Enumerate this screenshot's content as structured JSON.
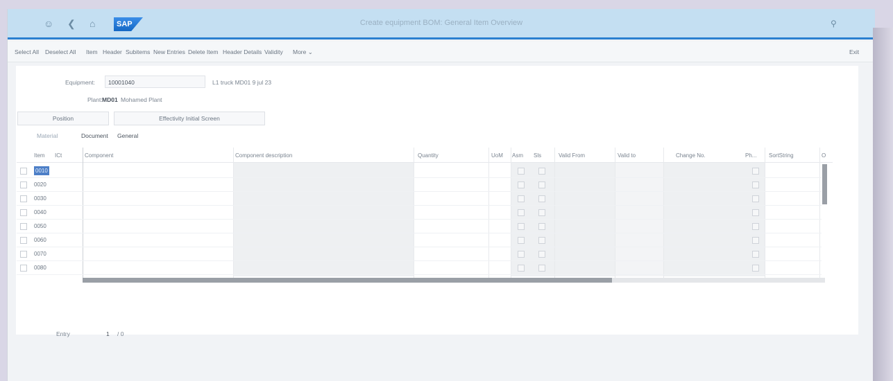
{
  "shell": {
    "title": "Create equipment BOM: General Item Overview",
    "logo_text": "SAP",
    "icons": [
      "user-icon",
      "back-icon",
      "home-icon",
      "search-icon"
    ]
  },
  "toolbar": {
    "buttons": [
      "Select All",
      "Deselect All",
      "Item",
      "Header",
      "Subitems",
      "New Entries",
      "Delete Item",
      "Header Details",
      "Validity",
      "More"
    ],
    "more_caret": "⌄",
    "exit": "Exit"
  },
  "header_fields": {
    "equipment_label": "Equipment:",
    "equipment_value": "10001040",
    "equipment_desc": "L1 truck MD01 9 jul 23",
    "plant_label": "Plant:",
    "plant_code": "MD01",
    "plant_name": "Mohamed Plant"
  },
  "buttons": {
    "position": "Position",
    "effectivity": "Effectivity Initial Screen"
  },
  "tabs": {
    "material": "Material",
    "document": "Document",
    "general": "General"
  },
  "table": {
    "columns": [
      "Item",
      "ICt",
      "Component",
      "Component description",
      "Quantity",
      "UoM",
      "Asm",
      "Sls",
      "Valid From",
      "Valid to",
      "Change No.",
      "Ph...",
      "SortString",
      "O"
    ],
    "rows": [
      "0010",
      "0020",
      "0030",
      "0040",
      "0050",
      "0060",
      "0070",
      "0080"
    ]
  },
  "footer": {
    "entry_label": "Entry",
    "entry_value": "1",
    "entry_total": "/ 0"
  },
  "colors": {
    "shell_bg": "#c4dff2",
    "accent": "#2a7fd0",
    "selection": "#4d7fc7"
  }
}
